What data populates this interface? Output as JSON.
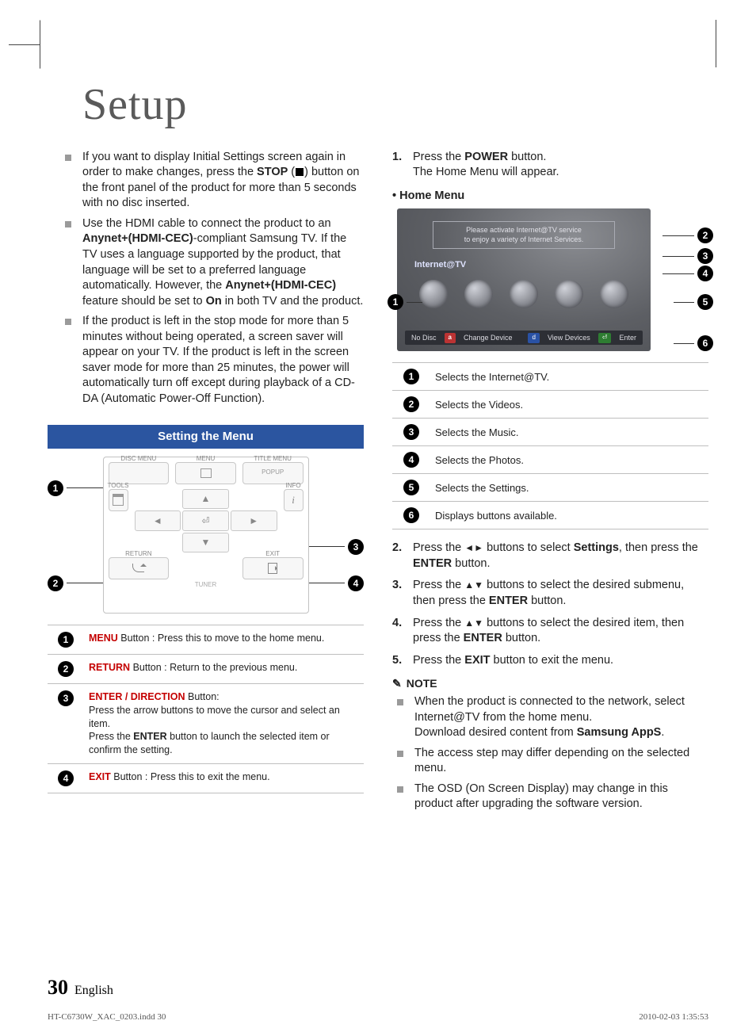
{
  "title": "Setup",
  "left": {
    "bullets": [
      {
        "pre": "If you want to display Initial Settings screen again in order to make changes, press the ",
        "strong1": "STOP",
        "paren_pre": " (",
        "paren_post": ") button on the front panel of the product for more than 5 seconds with no disc inserted."
      },
      {
        "pre": "Use the HDMI cable to connect the product to an ",
        "strong1": "Anynet+(HDMI-CEC)",
        "mid1": "-compliant Samsung TV. If the TV uses a language supported by the product, that language will be set to a preferred language automatically. However, the ",
        "strong2": "Anynet+(HDMI-CEC)",
        "mid2": " feature should be set to ",
        "strong3": "On",
        "post": " in both TV and the product."
      },
      {
        "plain": "If the product is left in the stop mode for more than 5 minutes without being operated, a screen saver will appear on your TV. If the product is left in the screen saver mode for more than 25 minutes, the power will automatically turn off except during playback of a CD-DA (Automatic Power-Off Function)."
      }
    ],
    "section_bar": "Setting the Menu",
    "remote": {
      "disc_menu": "DISC MENU",
      "menu": "MENU",
      "title_menu": "TITLE MENU",
      "popup": "POPUP",
      "tools": "TOOLS",
      "info": "INFO",
      "return": "RETURN",
      "exit": "EXIT",
      "tuner": "TUNER"
    },
    "callouts": {
      "1": "1",
      "2": "2",
      "3": "3",
      "4": "4"
    },
    "legend": [
      {
        "n": "1",
        "strong": "MENU",
        "text": " Button : Press this to move to the home menu."
      },
      {
        "n": "2",
        "strong": "RETURN",
        "text": " Button : Return to the previous menu."
      },
      {
        "n": "3",
        "strong": "ENTER / DIRECTION",
        "text": " Button:",
        "line2": "Press the arrow buttons to move the cursor and select an item.",
        "line3_pre": "Press the ",
        "line3_strong": "ENTER",
        "line3_post": " button to launch the selected item or confirm the setting."
      },
      {
        "n": "4",
        "strong": "EXIT",
        "text": " Button : Press this to exit the menu."
      }
    ]
  },
  "right": {
    "step1": {
      "pre": "Press the ",
      "strong": "POWER",
      "post": " button.",
      "line2": "The Home Menu will appear."
    },
    "home_heading": "Home Menu",
    "panel": {
      "banner_l1": "Please activate Internet@TV service",
      "banner_l2": "to enjoy a variety of Internet Services.",
      "tab": "Internet@TV",
      "bar_nodisc": "No Disc",
      "bar_change": "Change Device",
      "bar_view": "View Devices",
      "bar_enter": "Enter"
    },
    "home_legend": [
      {
        "n": "1",
        "t": "Selects the Internet@TV."
      },
      {
        "n": "2",
        "t": "Selects the Videos."
      },
      {
        "n": "3",
        "t": "Selects the Music."
      },
      {
        "n": "4",
        "t": "Selects the Photos."
      },
      {
        "n": "5",
        "t": "Selects the Settings."
      },
      {
        "n": "6",
        "t": "Displays buttons available."
      }
    ],
    "steps_rest": [
      {
        "pre": "Press the ",
        "arrows": "◄►",
        "mid": " buttons to select ",
        "strong1": "Settings",
        "mid2": ", then press the ",
        "strong2": "ENTER",
        "post": " button."
      },
      {
        "pre": "Press the ",
        "arrows": "▲▼",
        "mid": " buttons to select the desired submenu, then press the ",
        "strong1": "ENTER",
        "post": " button."
      },
      {
        "pre": "Press the ",
        "arrows": "▲▼",
        "mid": " buttons to select the desired item, then press the ",
        "strong1": "ENTER",
        "post": " button."
      },
      {
        "pre": "Press the ",
        "strong1": "EXIT",
        "post": " button to exit the menu."
      }
    ],
    "note_label": "NOTE",
    "notes": [
      {
        "l1": "When the product is connected to the network, select Internet@TV from the home menu.",
        "l2_pre": "Download desired content from ",
        "l2_strong": "Samsung AppS",
        "l2_post": "."
      },
      {
        "plain": "The access step may differ depending on the selected menu."
      },
      {
        "plain": "The OSD (On Screen Display) may change in this product after upgrading the software version."
      }
    ]
  },
  "footer": {
    "page": "30",
    "lang": "English"
  },
  "imprint": {
    "file": "HT-C6730W_XAC_0203.indd   30",
    "stamp": "2010-02-03   1:35:53"
  }
}
